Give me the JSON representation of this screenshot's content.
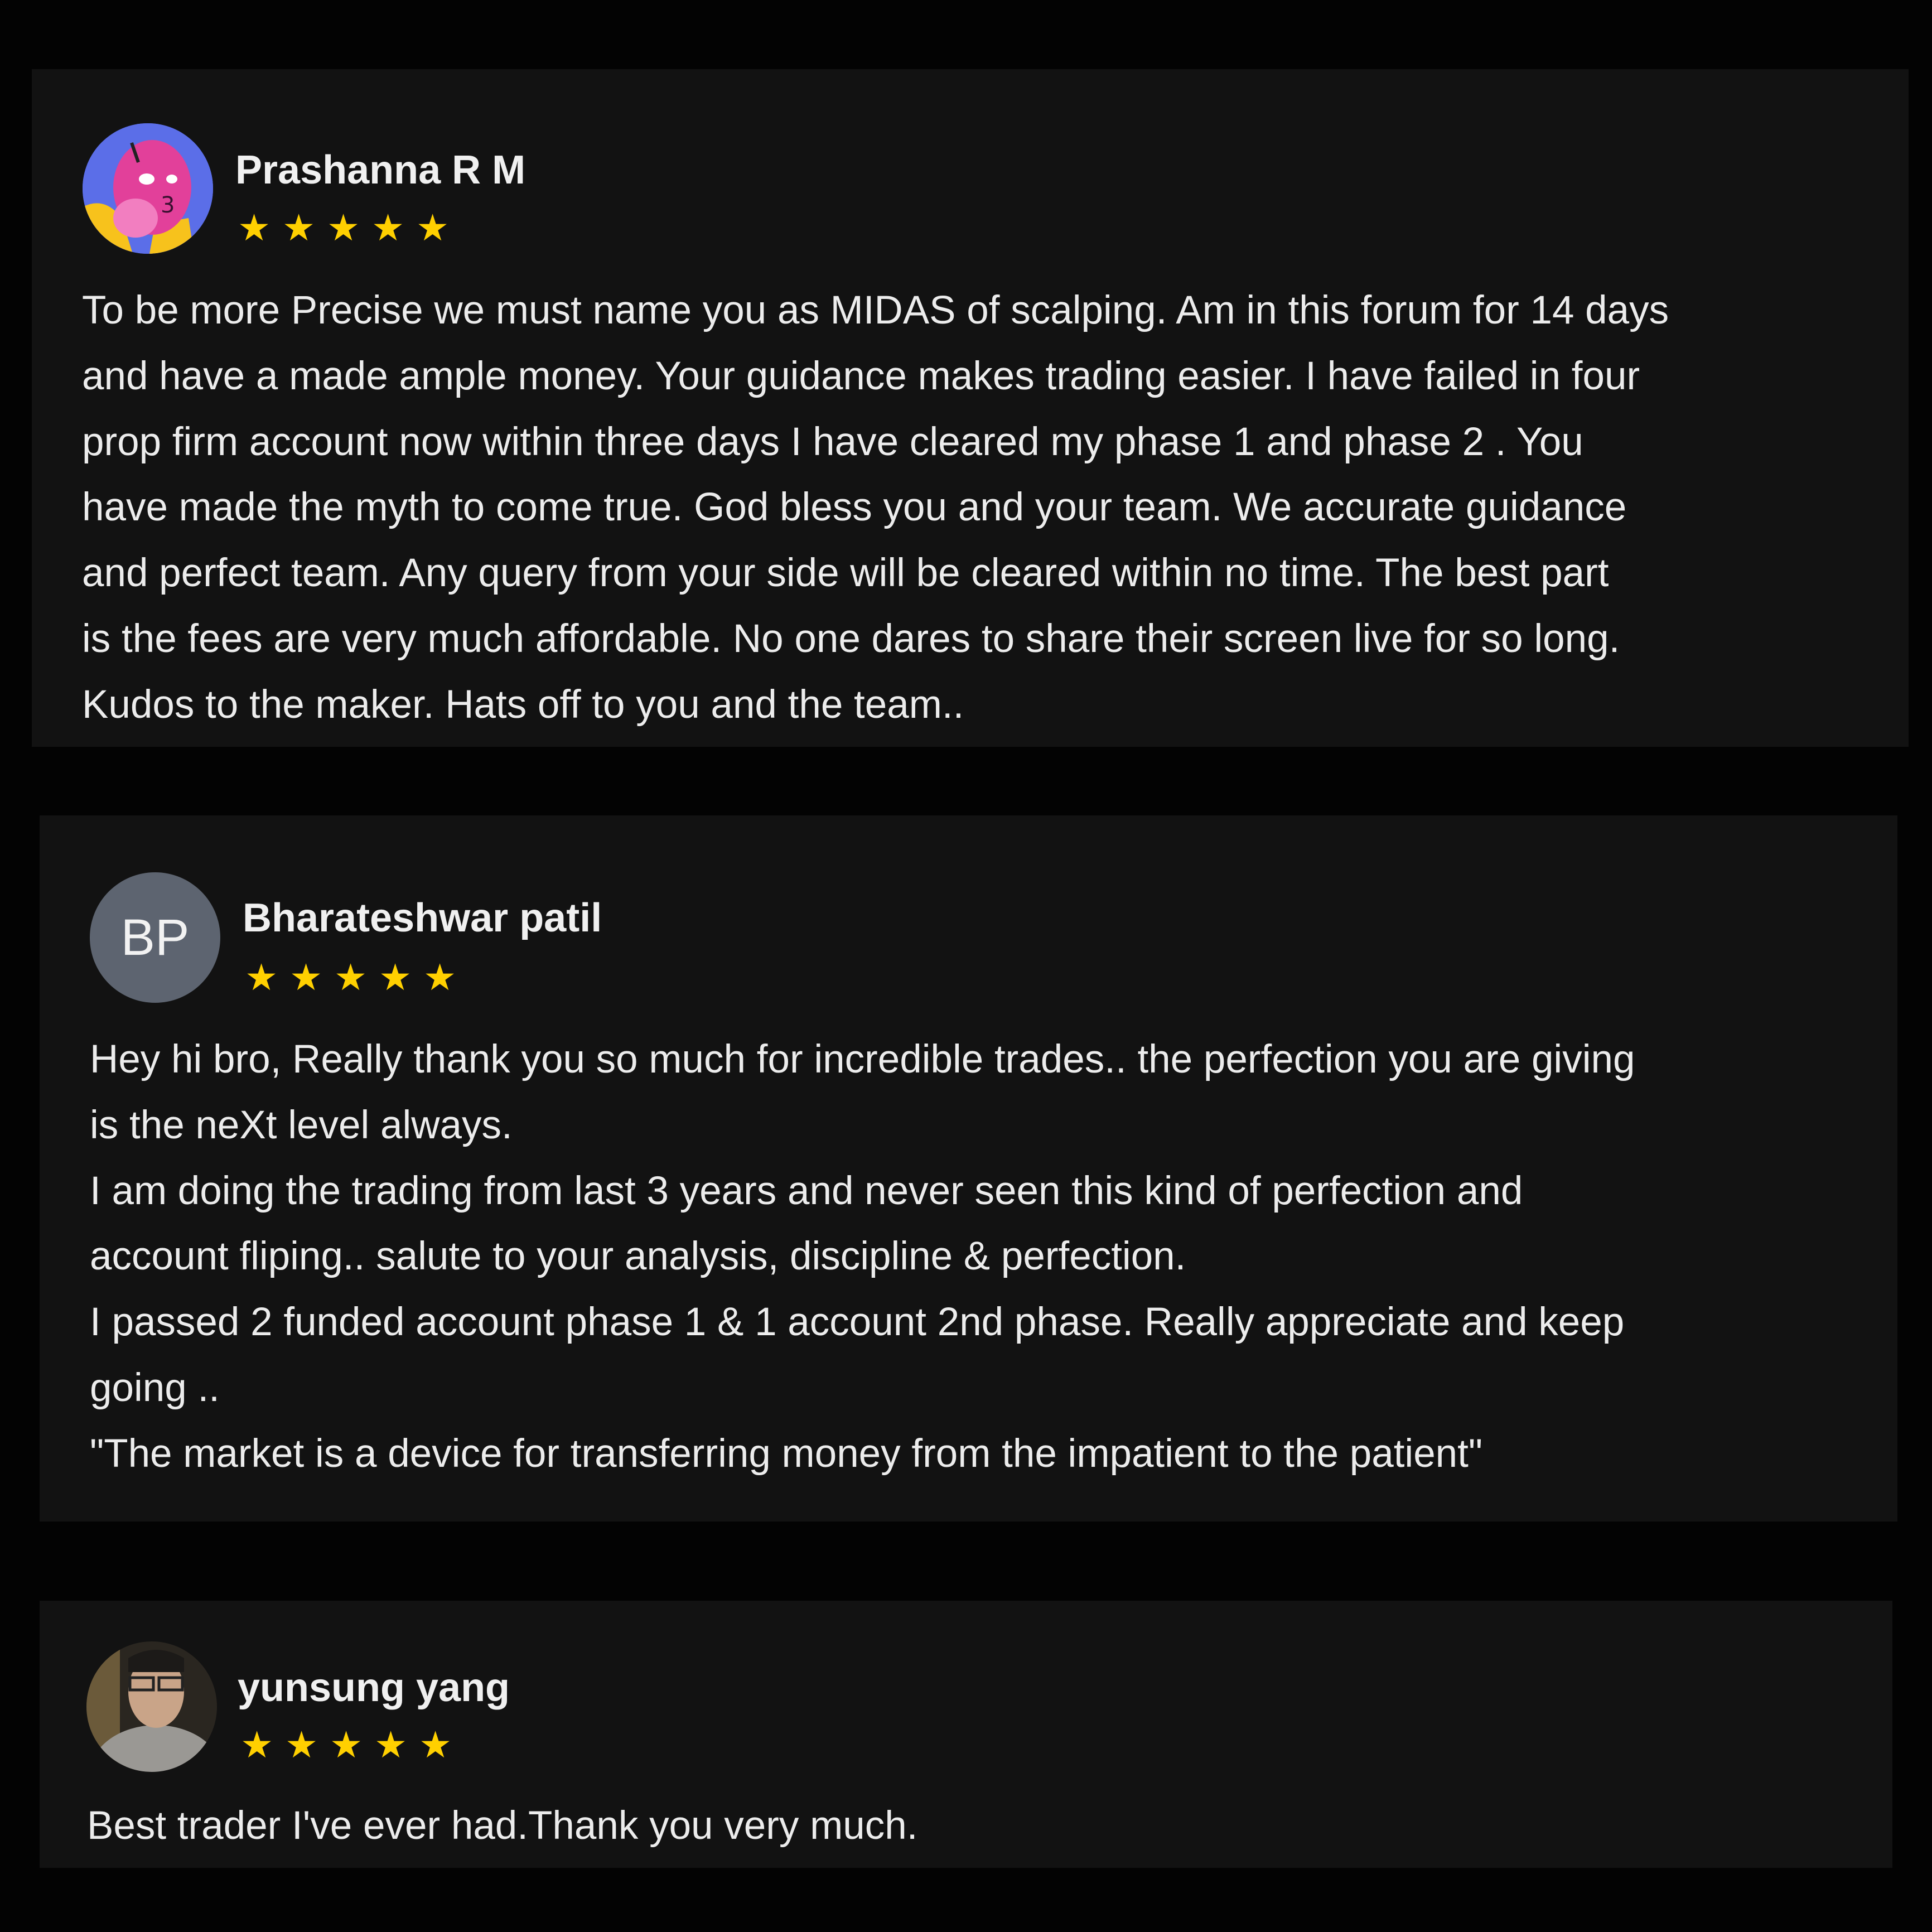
{
  "colors": {
    "page_bg": "#030303",
    "card_bg": "#121212",
    "star": "#ffd000",
    "text": "#ececec",
    "initials_bg": "#5d6470"
  },
  "reviews": [
    {
      "name": "Prashanna R M",
      "rating": 5,
      "avatar": "cartoon-avatar",
      "lines": [
        "To be more Precise we must name you as MIDAS of scalping. Am in this forum for 14 days",
        "and have a made ample money. Your guidance makes trading easier. I have failed in four",
        "prop firm account now within three days I have cleared my phase 1 and phase 2 . You",
        "have made the myth to come true. God bless you and your team. We accurate guidance",
        "and perfect team. Any query from your side will be cleared within no time. The best part",
        "is the fees are very much affordable. No one dares to share their screen live for so long.",
        "Kudos to the maker. Hats off to you and the team.."
      ]
    },
    {
      "name": "Bharateshwar patil",
      "rating": 5,
      "initials": "BP",
      "lines": [
        "Hey hi bro, Really thank you so much for incredible trades.. the perfection you are giving",
        "is the neXt level always.",
        "I am doing the trading from last 3 years and never seen this kind of perfection and",
        "account fliping.. salute to your analysis, discipline & perfection.",
        "I passed 2 funded account phase 1 & 1 account 2nd phase. Really appreciate and keep",
        "going ..",
        "\"The market is a device for transferring money from the impatient to the patient\""
      ]
    },
    {
      "name": "yunsung yang",
      "rating": 5,
      "avatar": "photo-avatar",
      "lines": [
        "Best trader I've ever had.Thank you very much."
      ]
    }
  ]
}
